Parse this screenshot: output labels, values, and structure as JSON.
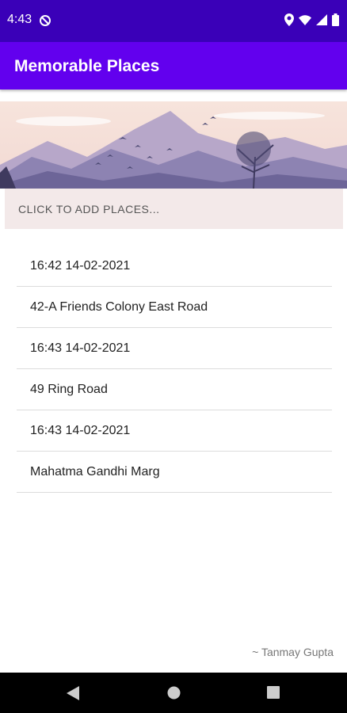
{
  "status": {
    "time": "4:43"
  },
  "app": {
    "title": "Memorable Places"
  },
  "add_button": {
    "label": "CLICK TO ADD PLACES..."
  },
  "places": [
    "16:42 14-02-2021",
    "42-A Friends Colony East Road",
    "16:43 14-02-2021",
    "49 Ring Road",
    "16:43 14-02-2021",
    "Mahatma Gandhi Marg"
  ],
  "footer": {
    "credit": "~ Tanmay Gupta"
  },
  "colors": {
    "status_bar": "#3a00b8",
    "app_bar": "#6200ee",
    "button_bg": "#f3e9e9"
  },
  "icons": [
    "data-saver-icon",
    "location-icon",
    "wifi-icon",
    "signal-icon",
    "battery-icon",
    "back-icon",
    "home-icon",
    "recents-icon"
  ]
}
